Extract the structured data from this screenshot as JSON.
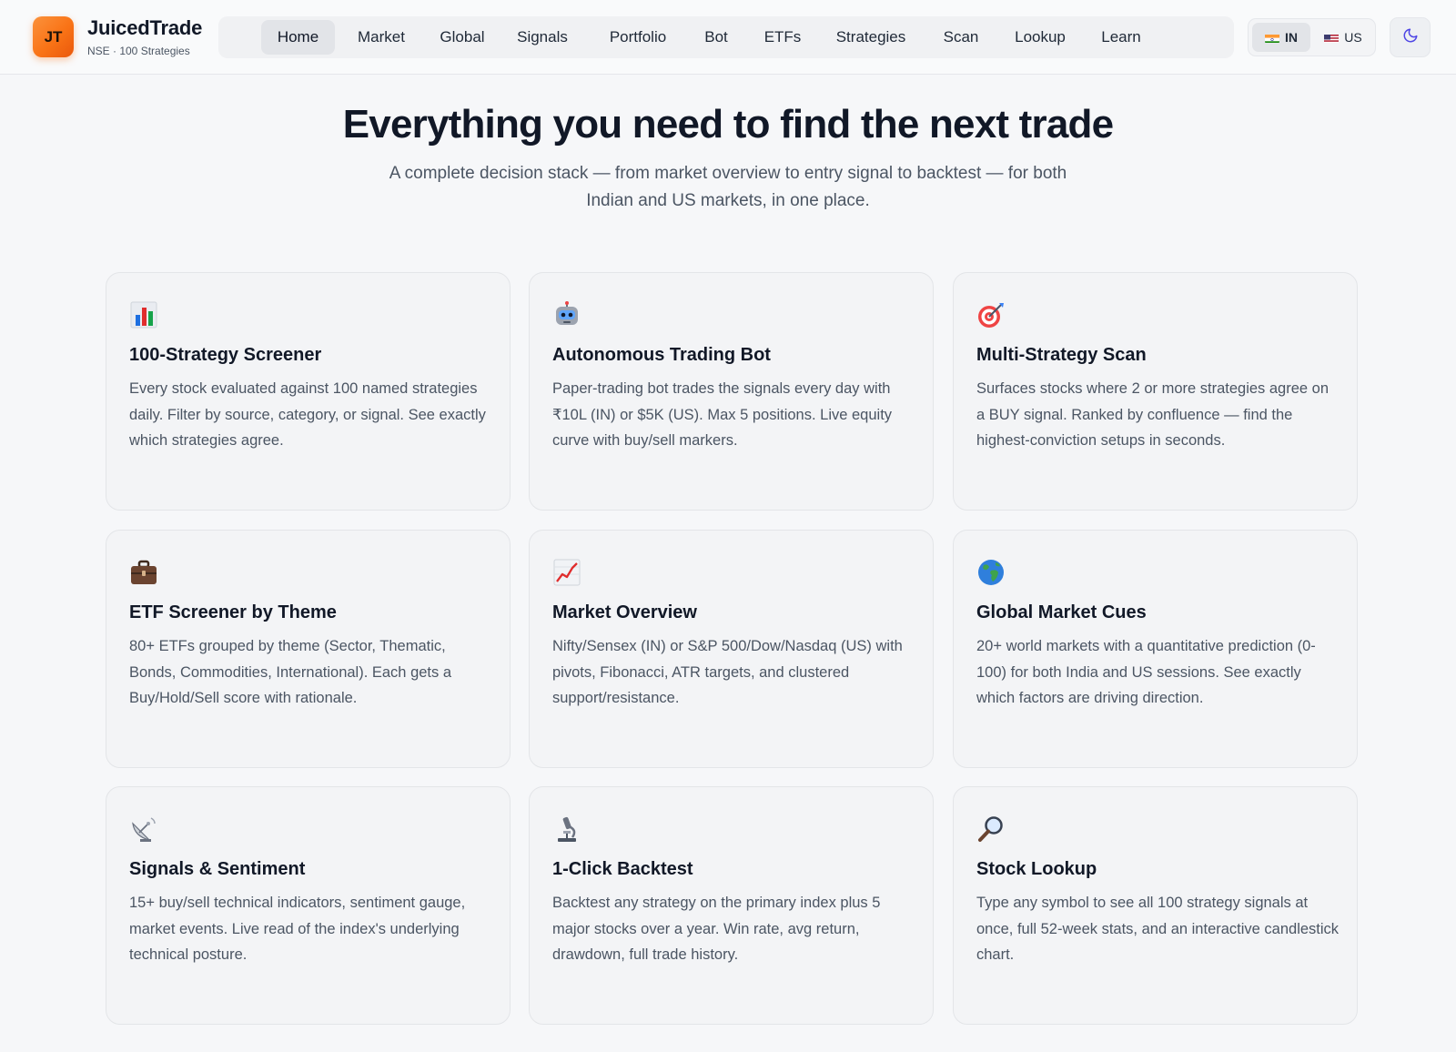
{
  "brand": {
    "logo_initials": "JT",
    "name": "JuicedTrade",
    "subtitle": "NSE · 100 Strategies"
  },
  "nav": {
    "tabs": [
      {
        "label": "Home",
        "active": true
      },
      {
        "label": "Market",
        "active": false
      },
      {
        "label": "Global",
        "active": false
      },
      {
        "label": "Signals",
        "active": false
      },
      {
        "label": "Portfolio",
        "active": false
      },
      {
        "label": "Bot",
        "active": false
      },
      {
        "label": "ETFs",
        "active": false
      },
      {
        "label": "Strategies",
        "active": false
      },
      {
        "label": "Scan",
        "active": false
      },
      {
        "label": "Lookup",
        "active": false
      },
      {
        "label": "Learn",
        "active": false
      }
    ]
  },
  "market_toggle": {
    "options": [
      {
        "label": "IN",
        "flag": "india-flag-icon",
        "active": true
      },
      {
        "label": "US",
        "flag": "us-flag-icon",
        "active": false
      }
    ]
  },
  "theme_toggle": {
    "icon": "moon-icon"
  },
  "hero": {
    "title": "Everything you need to find the next trade",
    "subtitle_line1": "A complete decision stack — from market overview to entry signal to backtest — for both",
    "subtitle_line2": "Indian and US markets, in one place."
  },
  "features": [
    {
      "icon": "bar-chart-icon",
      "title": "100-Strategy Screener",
      "description": "Every stock evaluated against 100 named strategies daily. Filter by source, category, or signal. See exactly which strategies agree."
    },
    {
      "icon": "robot-icon",
      "title": "Autonomous Trading Bot",
      "description": "Paper-trading bot trades the signals every day with ₹10L (IN) or $5K (US). Max 5 positions. Live equity curve with buy/sell markers."
    },
    {
      "icon": "target-icon",
      "title": "Multi-Strategy Scan",
      "description": "Surfaces stocks where 2 or more strategies agree on a BUY signal. Ranked by confluence — find the highest-conviction setups in seconds."
    },
    {
      "icon": "briefcase-icon",
      "title": "ETF Screener by Theme",
      "description": "80+ ETFs grouped by theme (Sector, Thematic, Bonds, Commodities, International). Each gets a Buy/Hold/Sell score with rationale."
    },
    {
      "icon": "trend-up-chart-icon",
      "title": "Market Overview",
      "description": "Nifty/Sensex (IN) or S&P 500/Dow/Nasdaq (US) with pivots, Fibonacci, ATR targets, and clustered support/resistance."
    },
    {
      "icon": "globe-icon",
      "title": "Global Market Cues",
      "description": "20+ world markets with a quantitative prediction (0-100) for both India and US sessions. See exactly which factors are driving direction."
    },
    {
      "icon": "satellite-dish-icon",
      "title": "Signals & Sentiment",
      "description": "15+ buy/sell technical indicators, sentiment gauge, market events. Live read of the index's underlying technical posture."
    },
    {
      "icon": "microscope-icon",
      "title": "1-Click Backtest",
      "description": "Backtest any strategy on the primary index plus 5 major stocks over a year. Win rate, avg return, drawdown, full trade history."
    },
    {
      "icon": "magnifier-icon",
      "title": "Stock Lookup",
      "description": "Type any symbol to see all 100 strategy signals at once, full 52-week stats, and an interactive candlestick chart."
    }
  ]
}
